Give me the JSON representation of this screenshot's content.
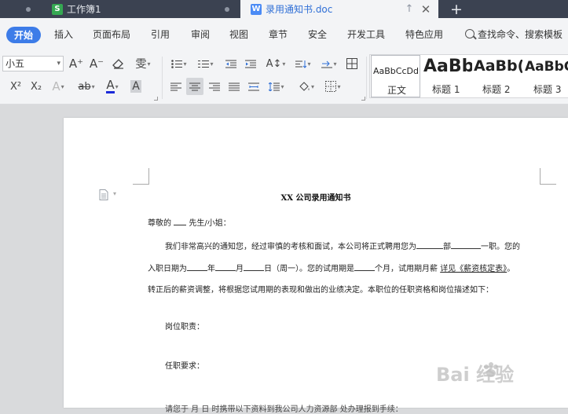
{
  "tabs": {
    "workbook": {
      "label": "工作簿1",
      "icon": "S"
    },
    "document": {
      "label": "录用通知书.doc",
      "icon": "W"
    }
  },
  "menu": {
    "start": "开始",
    "items": [
      "插入",
      "页面布局",
      "引用",
      "审阅",
      "视图",
      "章节",
      "安全",
      "开发工具",
      "特色应用"
    ],
    "search": "查找命令、搜索模板"
  },
  "ribbon": {
    "font_size": "小五",
    "grow_font": "A⁺",
    "shrink_font": "A⁻",
    "superscript": "X²",
    "subscript": "X₂",
    "text_effect": "A",
    "highlight": "ab",
    "font_color": "A",
    "char_shading": "A",
    "phonetic": "雯"
  },
  "styles": [
    {
      "sample": "AaBbCcDd",
      "name": "正文"
    },
    {
      "sample": "AaBb",
      "name": "标题 1"
    },
    {
      "sample": "AaBb(",
      "name": "标题 2"
    },
    {
      "sample": "AaBbC",
      "name": "标题 3"
    }
  ],
  "document": {
    "title": "XX 公司录用通知书",
    "salutation_a": "尊敬的 ",
    "salutation_b": " 先生/小姐：",
    "p1_a": "我们非常高兴的通知您，经过审慎的考核和面试，本公司将正式聘用您为",
    "p1_b": "部",
    "p1_c": "一职。您的",
    "p2_a": "入职日期为",
    "p2_b": "年",
    "p2_c": "月",
    "p2_d": "日（周一）。您的试用期是",
    "p2_e": "个月，试用期月薪 ",
    "p2_link": "详见《薪资核定表》",
    "p2_end": "。",
    "p3": "转正后的薪资调整，将根据您试用期的表现和做出的业绩决定。本职位的任职资格和岗位描述如下：",
    "duty": "岗位职责：",
    "req": "任职要求：",
    "p_last": "请您于    月    日    时携带以下资料到我公司人力资源部         处办理报到手续："
  },
  "watermark": {
    "text": "Bai  经验"
  }
}
